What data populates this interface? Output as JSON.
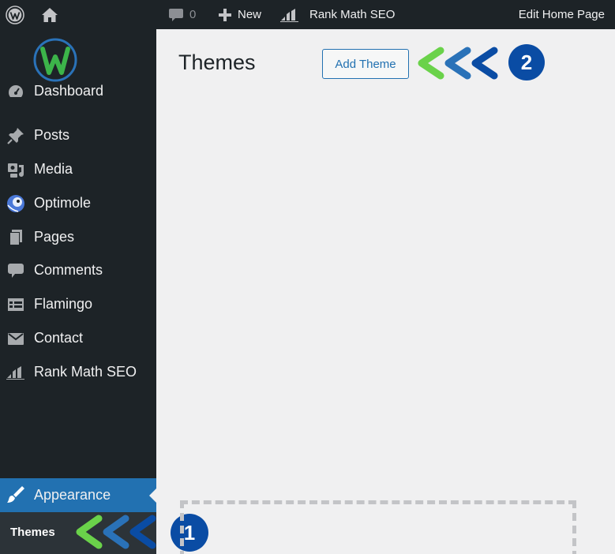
{
  "admin_bar": {
    "comment_count": "0",
    "new_label": "New",
    "rank_math_label": "Rank Math SEO",
    "edit_label": "Edit Home Page"
  },
  "sidebar": {
    "logo_icon": "w-logo-icon",
    "items": [
      {
        "label": "Dashboard",
        "icon": "dashboard-icon"
      },
      {
        "label": "Posts",
        "icon": "pin-icon"
      },
      {
        "label": "Media",
        "icon": "media-icon"
      },
      {
        "label": "Optimole",
        "icon": "optimole-icon"
      },
      {
        "label": "Pages",
        "icon": "pages-icon"
      },
      {
        "label": "Comments",
        "icon": "comment-icon"
      },
      {
        "label": "Flamingo",
        "icon": "flamingo-icon"
      },
      {
        "label": "Contact",
        "icon": "envelope-icon"
      },
      {
        "label": "Rank Math SEO",
        "icon": "rank-math-icon"
      }
    ],
    "active": {
      "label": "Appearance",
      "icon": "paintbrush-icon"
    },
    "submenu": {
      "label": "Themes"
    }
  },
  "main": {
    "title": "Themes",
    "add_button": "Add Theme"
  },
  "annotations": {
    "badge_1": "1",
    "badge_2": "2"
  },
  "colors": {
    "sidebar_bg": "#1d2327",
    "accent_blue": "#2271b1",
    "badge_blue": "#0a4ca4",
    "chevron_green": "#6ad24a",
    "chevron_mid": "#2a72b8",
    "chevron_dark": "#0a4ca4",
    "content_bg": "#f0f0f1"
  }
}
